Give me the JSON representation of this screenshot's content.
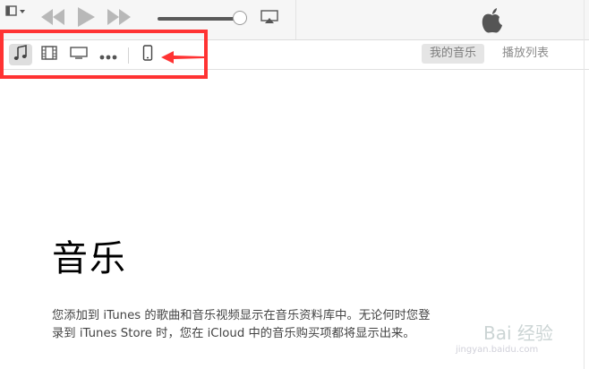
{
  "tabs": {
    "my_music": "我的音乐",
    "playlists": "播放列表"
  },
  "main": {
    "title": "音乐",
    "description_line1": "您添加到 iTunes 的歌曲和音乐视频显示在音乐资料库中。无论何时您登",
    "description_line2": "录到 iTunes Store 时，您在 iCloud 中的音乐购买项都将显示出来。"
  },
  "watermark": {
    "text": "Bai 经验",
    "url": "jingyan.baidu.com"
  },
  "colors": {
    "highlight": "#ff3333",
    "toolbar_bg": "#f6f6f6",
    "selected_tab_bg": "#e5e5e5"
  },
  "icons": [
    "menu-icon",
    "rewind-icon",
    "play-icon",
    "fast-forward-icon",
    "airplay-icon",
    "apple-logo-icon",
    "music-note-icon",
    "film-icon",
    "tv-icon",
    "more-icon",
    "iphone-icon",
    "arrow-icon"
  ],
  "volume_level": 0.88
}
